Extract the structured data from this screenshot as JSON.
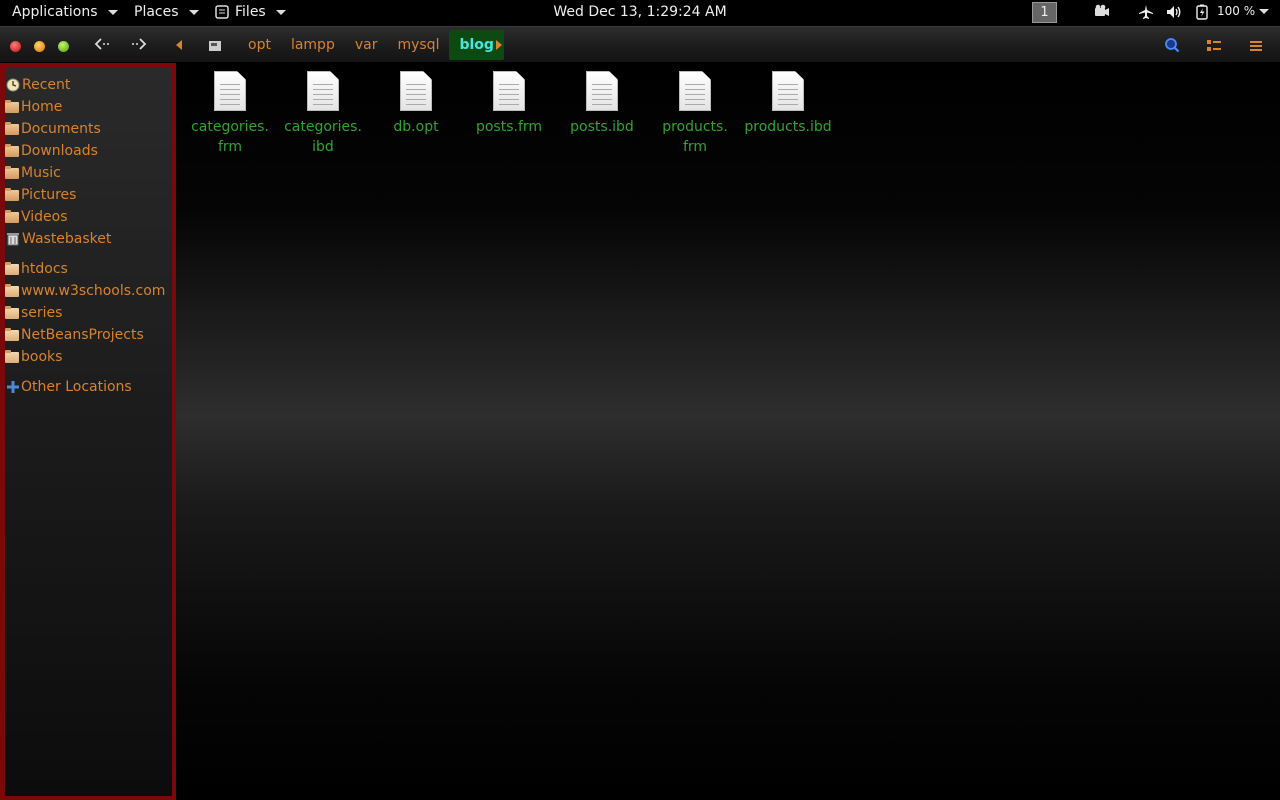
{
  "topbar": {
    "applications": "Applications",
    "places": "Places",
    "files": "Files",
    "clock": "Wed Dec 13,  1:29:24 AM",
    "workspace": "1",
    "battery_pct": "100 %"
  },
  "toolbar": {
    "path": [
      "opt",
      "lampp",
      "var",
      "mysql",
      "blog"
    ]
  },
  "sidebar": {
    "places": [
      {
        "label": "Recent",
        "icon": "recent-icon"
      },
      {
        "label": "Home",
        "icon": "home-folder-icon"
      },
      {
        "label": "Documents",
        "icon": "documents-folder-icon"
      },
      {
        "label": "Downloads",
        "icon": "downloads-folder-icon"
      },
      {
        "label": "Music",
        "icon": "music-folder-icon"
      },
      {
        "label": "Pictures",
        "icon": "pictures-folder-icon"
      },
      {
        "label": "Videos",
        "icon": "videos-folder-icon"
      },
      {
        "label": "Wastebasket",
        "icon": "trash-icon"
      }
    ],
    "bookmarks": [
      {
        "label": "htdocs"
      },
      {
        "label": "www.w3schools.com"
      },
      {
        "label": "series"
      },
      {
        "label": "NetBeansProjects"
      },
      {
        "label": "books"
      }
    ],
    "other": "Other Locations"
  },
  "files": [
    {
      "line1": "categories.",
      "line2": "frm"
    },
    {
      "line1": "categories.",
      "line2": "ibd"
    },
    {
      "line1": "db.opt",
      "line2": ""
    },
    {
      "line1": "posts.frm",
      "line2": ""
    },
    {
      "line1": "posts.ibd",
      "line2": ""
    },
    {
      "line1": "products.",
      "line2": "frm"
    },
    {
      "line1": "products.ibd",
      "line2": ""
    }
  ],
  "colors": {
    "accent": "#d9832f",
    "file_text": "#2fa42f",
    "active_crumb_bg": "#0c4a12",
    "active_crumb_text": "#40e8e0",
    "sidebar_border": "#7a0a0a"
  }
}
